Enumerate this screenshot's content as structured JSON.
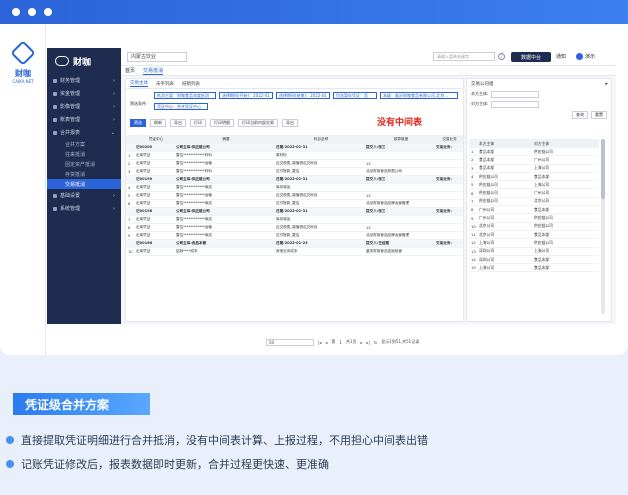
{
  "app": {
    "brand": "财咖",
    "outer_brand": "财咖",
    "outer_brand_sub": "CAIKA.NET"
  },
  "sidebar": {
    "items": [
      {
        "label": "财务管理"
      },
      {
        "label": "资金管理"
      },
      {
        "label": "影像管理"
      },
      {
        "label": "账表管理"
      },
      {
        "label": "合并报表"
      }
    ],
    "subitems": [
      {
        "label": "合并方案"
      },
      {
        "label": "往来抵消"
      },
      {
        "label": "固定资产抵消"
      },
      {
        "label": "存货抵消"
      },
      {
        "label": "交易抵消"
      }
    ],
    "bottom_items": [
      {
        "label": "基础设置"
      },
      {
        "label": "系统管理"
      }
    ]
  },
  "topbar": {
    "company": "内蒙古饮业",
    "search_placeholder": "请输入菜单关键字",
    "data_center_button": "数据中台",
    "notice": "通知",
    "user": "演示"
  },
  "tabs": [
    {
      "label": "首页"
    },
    {
      "label": "交易抵消"
    }
  ],
  "panel": {
    "subtabs": [
      "交易主体",
      "未平列表",
      "抵销列表"
    ],
    "filter_label": "筛选条件:",
    "filters": [
      "抵消方案：财咖食品年度抵消",
      "选择期间(开始)：2022-01",
      "选择期间(结束)：2022-01",
      "包含暂存凭证：否",
      "本级：临沂财咖食品有限公司,北京...",
      "凭证中心：合并凭证中心"
    ],
    "actions": [
      "筛选",
      "刷新",
      "导出",
      "打印",
      "打印明细",
      "打印当前内部交易",
      "导出"
    ],
    "headline": "没有中间表",
    "columns": [
      "",
      "凭证中心",
      "摘要",
      "科目全称",
      "核算维度",
      "交易业务"
    ],
    "rows": [
      {
        "type": "group",
        "cells": [
          "",
          "记00200",
          "公司主体:供应链公司",
          "日期:2022-01-31",
          "提交人:张三",
          "交易业务:"
        ]
      },
      {
        "type": "row",
        "cells": [
          "1",
          "出库凭证",
          "暂估************材料",
          "原材料",
          "",
          ""
        ]
      },
      {
        "type": "row",
        "cells": [
          "2",
          "出库凭证",
          "暂估************运输",
          "应交税费_增值税应交科目",
          "13",
          ""
        ]
      },
      {
        "type": "row",
        "cells": [
          "3",
          "出库凭证",
          "暂估************材料",
          "应付账款_暂估",
          "北京财咖食品有限公司",
          ""
        ]
      },
      {
        "type": "group",
        "cells": [
          "",
          "记00199",
          "公司主体:供应链公司",
          "日期:2022-01-31",
          "提交人:张三",
          "交易业务:"
        ]
      },
      {
        "type": "row",
        "cells": [
          "4",
          "出库凭证",
          "暂估************商品",
          "库存商品",
          "",
          ""
        ]
      },
      {
        "type": "row",
        "cells": [
          "5",
          "出库凭证",
          "暂估************运输",
          "应交税费_增值税应交科目",
          "13",
          ""
        ]
      },
      {
        "type": "row",
        "cells": [
          "6",
          "出库凭证",
          "暂估************商品",
          "应付账款_暂估",
          "北京财咖食品品牌运营管理",
          ""
        ]
      },
      {
        "type": "group",
        "cells": [
          "",
          "记00198",
          "公司主体:供应链公司",
          "日期:2022-01-31",
          "提交人:张三",
          "交易业务:"
        ]
      },
      {
        "type": "row",
        "cells": [
          "7",
          "出库凭证",
          "暂估************商品",
          "库存商品",
          "",
          ""
        ]
      },
      {
        "type": "row",
        "cells": [
          "8",
          "出库凭证",
          "暂估************运输",
          "应交税费_增值税应交科目",
          "13",
          ""
        ]
      },
      {
        "type": "row",
        "cells": [
          "9",
          "出库凭证",
          "暂估************商品",
          "应付账款_暂估",
          "北京财咖食品品牌运营管理",
          ""
        ]
      },
      {
        "type": "group",
        "cells": [
          "",
          "记00166",
          "公司主体:食品本部",
          "日期:2022-01-23",
          "提交人:王经理",
          "交易业务:"
        ]
      },
      {
        "type": "row",
        "cells": [
          "10",
          "出库凭证",
          "结转****成本",
          "其他业务成本",
          "重庆财咖食品连锁经营",
          ""
        ]
      }
    ],
    "pager": {
      "page_size": "50",
      "page_label": "第",
      "page": "1",
      "total_pages": "共1页",
      "summary": "显示1到51,共51记录"
    }
  },
  "right_panel": {
    "title": "交易公司组",
    "field1": "本方主体:",
    "field2": "对方主体:",
    "query_button": "查询",
    "reset_button": "重置",
    "columns": [
      "",
      "本方主体",
      "对方主体"
    ],
    "rows": [
      [
        "1",
        "食品本部",
        "供应链公司"
      ],
      [
        "2",
        "食品本部",
        "广州公司"
      ],
      [
        "3",
        "食品本部",
        "上海公司"
      ],
      [
        "4",
        "供应链公司",
        "食品本部"
      ],
      [
        "5",
        "供应链公司",
        "上海公司"
      ],
      [
        "6",
        "供应链公司",
        "广州公司"
      ],
      [
        "7",
        "供应链公司",
        "北京公司"
      ],
      [
        "8",
        "广州公司",
        "食品本部"
      ],
      [
        "9",
        "广州公司",
        "供应链公司"
      ],
      [
        "10",
        "北京公司",
        "供应链公司"
      ],
      [
        "11",
        "北京公司",
        "食品本部"
      ],
      [
        "12",
        "上海公司",
        "供应链公司"
      ],
      [
        "13",
        "深圳公司",
        "上海公司"
      ],
      [
        "14",
        "深圳公司",
        "食品本部"
      ],
      [
        "15",
        "上海公司",
        "食品本部"
      ]
    ]
  },
  "promo": {
    "banner": "凭证级合并方案",
    "bullets": [
      "直接提取凭证明细进行合并抵消，没有中间表计算、上报过程，不用担心中间表出错",
      "记账凭证修改后，报表数据即时更新，合并过程更快速、更准确"
    ]
  }
}
